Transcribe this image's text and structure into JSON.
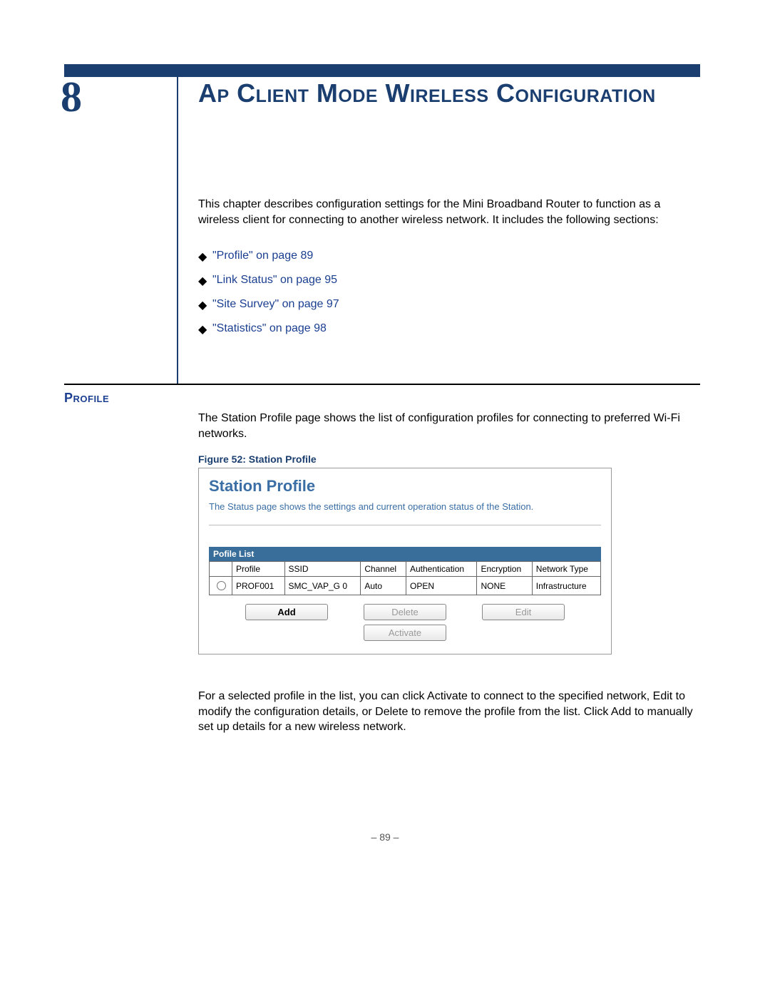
{
  "chapter": {
    "number": "8",
    "title": "Ap Client Mode Wireless Configuration"
  },
  "intro": "This chapter describes configuration settings for the Mini Broadband Router to function as a wireless client for connecting to another wireless network. It includes the following sections:",
  "bullets": [
    "\"Profile\" on page 89",
    "\"Link Status\" on page 95",
    "\"Site Survey\" on page 97",
    "\"Statistics\" on page 98"
  ],
  "section": {
    "label": "Profile",
    "body": "The Station Profile page shows the list of configuration profiles for connecting to preferred Wi-Fi networks."
  },
  "figure": {
    "caption": "Figure 52:  Station Profile",
    "title": "Station Profile",
    "subtitle": "The Status page shows the settings and current operation status of the Station.",
    "list_label": "Pofile List",
    "columns": [
      "",
      "Profile",
      "SSID",
      "Channel",
      "Authentication",
      "Encryption",
      "Network Type"
    ],
    "rows": [
      {
        "profile": "PROF001",
        "ssid": "SMC_VAP_G 0",
        "channel": "Auto",
        "auth": "OPEN",
        "enc": "NONE",
        "ntype": "Infrastructure"
      }
    ],
    "buttons": {
      "add": "Add",
      "delete": "Delete",
      "edit": "Edit",
      "activate": "Activate"
    }
  },
  "body2": "For a selected profile in the list, you can click Activate to connect to the specified network, Edit to modify the configuration details, or Delete to remove the profile from the list. Click Add to manually set up details for a new wireless network.",
  "footer": "–  89  –"
}
